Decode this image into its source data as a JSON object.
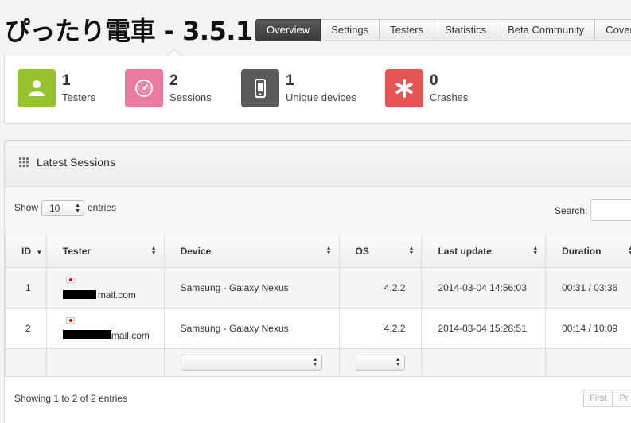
{
  "app": {
    "title": "ぴったり電車 - 3.5.1"
  },
  "tabs": [
    {
      "label": "Overview",
      "active": true
    },
    {
      "label": "Settings",
      "active": false
    },
    {
      "label": "Testers",
      "active": false
    },
    {
      "label": "Statistics",
      "active": false
    },
    {
      "label": "Beta Community",
      "active": false
    },
    {
      "label": "Coverage",
      "active": false
    }
  ],
  "stats": [
    {
      "value": "1",
      "label": "Testers",
      "icon": "person-icon",
      "color": "#96c22e"
    },
    {
      "value": "2",
      "label": "Sessions",
      "icon": "gauge-icon",
      "color": "#ea7ba0"
    },
    {
      "value": "1",
      "label": "Unique devices",
      "icon": "phone-icon",
      "color": "#5a5a5a"
    },
    {
      "value": "0",
      "label": "Crashes",
      "icon": "asterisk-icon",
      "color": "#e55454"
    }
  ],
  "sessions": {
    "title": "Latest Sessions",
    "show_label": "Show",
    "page_length": "10",
    "entries_label": "entries",
    "search_label": "Search:",
    "columns": [
      "ID",
      "Tester",
      "Device",
      "OS",
      "Last update",
      "Duration"
    ],
    "rows": [
      {
        "id": "1",
        "tester_email": "mail.com",
        "device": "Samsung - Galaxy Nexus",
        "os": "4.2.2",
        "last_update": "2014-03-04 14:56:03",
        "duration": "00:31 / 03:36"
      },
      {
        "id": "2",
        "tester_email": "mail.com",
        "device": "Samsung - Galaxy Nexus",
        "os": "4.2.2",
        "last_update": "2014-03-04 15:28:51",
        "duration": "00:14 / 10:09"
      }
    ],
    "info": "Showing 1 to 2 of 2 entries",
    "pager": [
      "First",
      "Pr"
    ]
  }
}
